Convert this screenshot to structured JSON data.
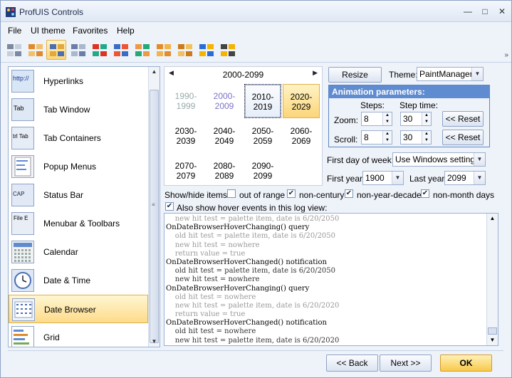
{
  "window": {
    "title": "ProfUIS Controls"
  },
  "menu": [
    "File",
    "UI theme",
    "Favorites",
    "Help"
  ],
  "toolbar": {
    "buttons": [
      {
        "icon": "theme-office2000-icon",
        "active": false
      },
      {
        "icon": "theme-officexp-icon",
        "active": false
      },
      {
        "icon": "theme-office2003-icon",
        "active": true
      },
      {
        "icon": "theme-studio2005-icon",
        "active": false
      },
      {
        "icon": "windows-flag-icon",
        "active": false
      },
      {
        "icon": "theme-native-xp-icon",
        "active": false
      },
      {
        "icon": "theme-native-icon",
        "active": false
      },
      {
        "icon": "theme-office2007-icon",
        "active": false
      },
      {
        "icon": "theme-office2007-alt-icon",
        "active": false
      },
      {
        "icon": "theme-ribbon-icon",
        "active": false
      },
      {
        "icon": "windows-logo-icon",
        "active": false
      }
    ]
  },
  "left_list": {
    "items": [
      {
        "label": "Hyperlinks",
        "icon": "hyperlink-thumb-icon"
      },
      {
        "label": "Tab Window",
        "icon": "tab-window-thumb-icon"
      },
      {
        "label": "Tab Containers",
        "icon": "tab-containers-thumb-icon"
      },
      {
        "label": "Popup Menus",
        "icon": "popup-menu-thumb-icon"
      },
      {
        "label": "Status Bar",
        "icon": "status-bar-thumb-icon"
      },
      {
        "label": "Menubar & Toolbars",
        "icon": "menubar-thumb-icon"
      },
      {
        "label": "Calendar",
        "icon": "calendar-thumb-icon"
      },
      {
        "label": "Date & Time",
        "icon": "clock-thumb-icon"
      },
      {
        "label": "Date Browser",
        "icon": "date-browser-thumb-icon",
        "selected": true
      },
      {
        "label": "Grid",
        "icon": "grid-thumb-icon"
      }
    ],
    "thumb_text": {
      "hyperlinks": "http://",
      "tab": "Tab",
      "trl_tab": "trl",
      "tab2": "Tab",
      "cap": "CAP",
      "file": "File",
      "edit": "E"
    }
  },
  "date_browser": {
    "header": "2000-2099",
    "cells": [
      {
        "label": "1990-\n1999",
        "state": "out"
      },
      {
        "label": "2000-\n2009",
        "state": "century"
      },
      {
        "label": "2010-\n2019",
        "state": "selected"
      },
      {
        "label": "2020-\n2029",
        "state": "today"
      },
      {
        "label": "2030-\n2039",
        "state": ""
      },
      {
        "label": "2040-\n2049",
        "state": ""
      },
      {
        "label": "2050-\n2059",
        "state": ""
      },
      {
        "label": "2060-\n2069",
        "state": ""
      },
      {
        "label": "2070-\n2079",
        "state": ""
      },
      {
        "label": "2080-\n2089",
        "state": ""
      },
      {
        "label": "2090-\n2099",
        "state": ""
      }
    ]
  },
  "controls": {
    "resize_label": "Resize",
    "theme_label": "Theme:",
    "theme_value": "PaintManager",
    "anim_title": "Animation parameters:",
    "steps_label": "Steps:",
    "step_time_label": "Step time:",
    "zoom_label": "Zoom:",
    "scroll_label": "Scroll:",
    "zoom_steps": "8",
    "zoom_time": "30",
    "scroll_steps": "8",
    "scroll_time": "30",
    "reset_label": "<< Reset",
    "first_day_label": "First day of week:",
    "first_day_value": "Use Windows settings",
    "first_year_label": "First year:",
    "first_year_value": "1900",
    "last_year_label": "Last year:",
    "last_year_value": "2099"
  },
  "show_hide": {
    "label": "Show/hide items:",
    "out_of_range": {
      "label": "out of range",
      "checked": false
    },
    "non_century": {
      "label": "non-century",
      "checked": true
    },
    "non_year_decade": {
      "label": "non-year-decade",
      "checked": true
    },
    "non_month_days": {
      "label": "non-month days",
      "checked": true
    },
    "hover_events": {
      "label": "Also show hover events in this log view:",
      "checked": true
    }
  },
  "log": {
    "lines": [
      {
        "text": "    new hit test = palette item, date is 6/20/2050",
        "kind": "d"
      },
      {
        "text": "OnDateBrowserHoverChanging() query",
        "kind": "q"
      },
      {
        "text": "    old hit test = palette item, date is 6/20/2050",
        "kind": "d"
      },
      {
        "text": "    new hit test = nowhere",
        "kind": "d"
      },
      {
        "text": "    return value = true",
        "kind": "d"
      },
      {
        "text": "OnDateBrowserHoverChanged() notification",
        "kind": "q"
      },
      {
        "text": "    old hit test = palette item, date is 6/20/2050",
        "kind": "n"
      },
      {
        "text": "    new hit test = nowhere",
        "kind": "n"
      },
      {
        "text": "OnDateBrowserHoverChanging() query",
        "kind": "q"
      },
      {
        "text": "    old hit test = nowhere",
        "kind": "d"
      },
      {
        "text": "    new hit test = palette item, date is 6/20/2020",
        "kind": "d"
      },
      {
        "text": "    return value = true",
        "kind": "d"
      },
      {
        "text": "OnDateBrowserHoverChanged() notification",
        "kind": "q"
      },
      {
        "text": "    old hit test = nowhere",
        "kind": "n"
      },
      {
        "text": "    new hit test = palette item, date is 6/20/2020",
        "kind": "n"
      }
    ]
  },
  "bottom": {
    "back_label": "<< Back",
    "next_label": "Next >>",
    "ok_label": "OK"
  }
}
